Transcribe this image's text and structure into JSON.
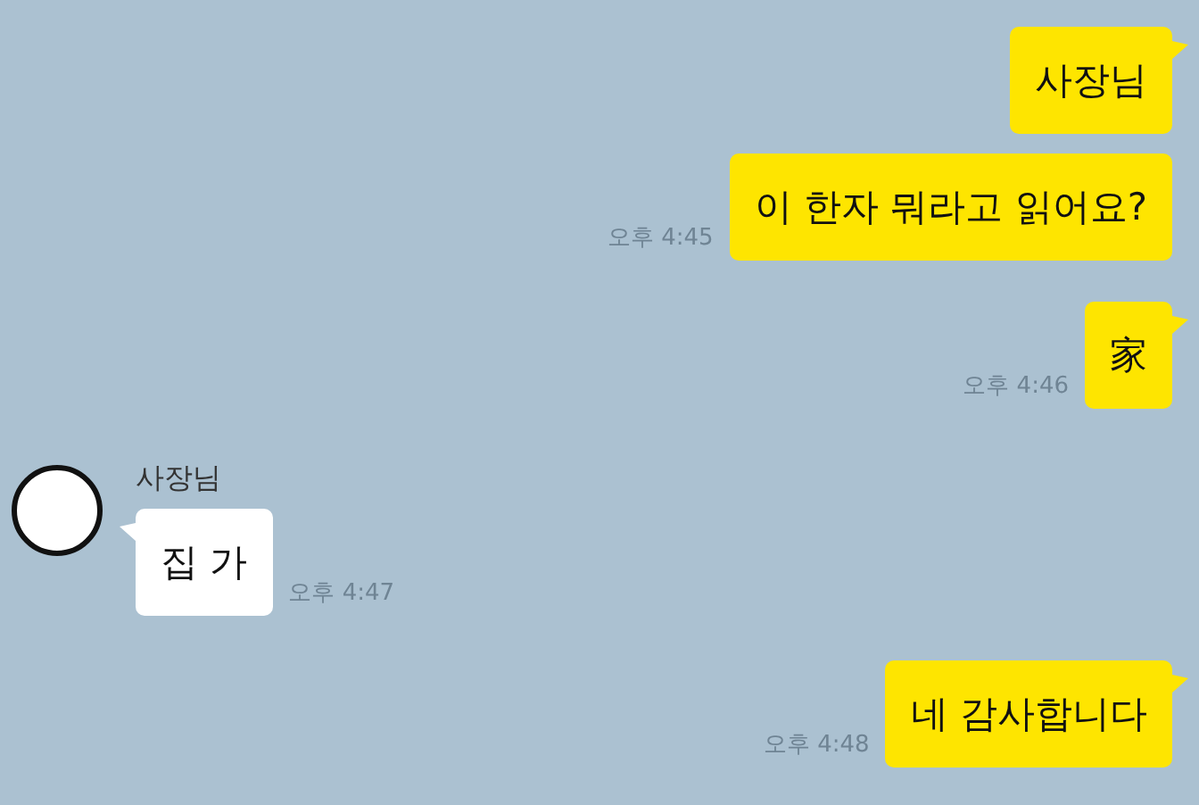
{
  "messages": [
    {
      "kind": "sent",
      "text": "사장님",
      "tail": true
    },
    {
      "kind": "sent",
      "text": "이 한자 뭐라고 읽어요?",
      "tail": false,
      "time": "오후 4:45"
    },
    {
      "kind": "sent",
      "text": "家",
      "tail": true,
      "time": "오후 4:46"
    },
    {
      "kind": "received",
      "sender": "사장님",
      "text": "집 가",
      "tail": true,
      "time": "오후 4:47"
    },
    {
      "kind": "sent",
      "text": "네 감사합니다",
      "tail": true,
      "time": "오후 4:48"
    }
  ]
}
